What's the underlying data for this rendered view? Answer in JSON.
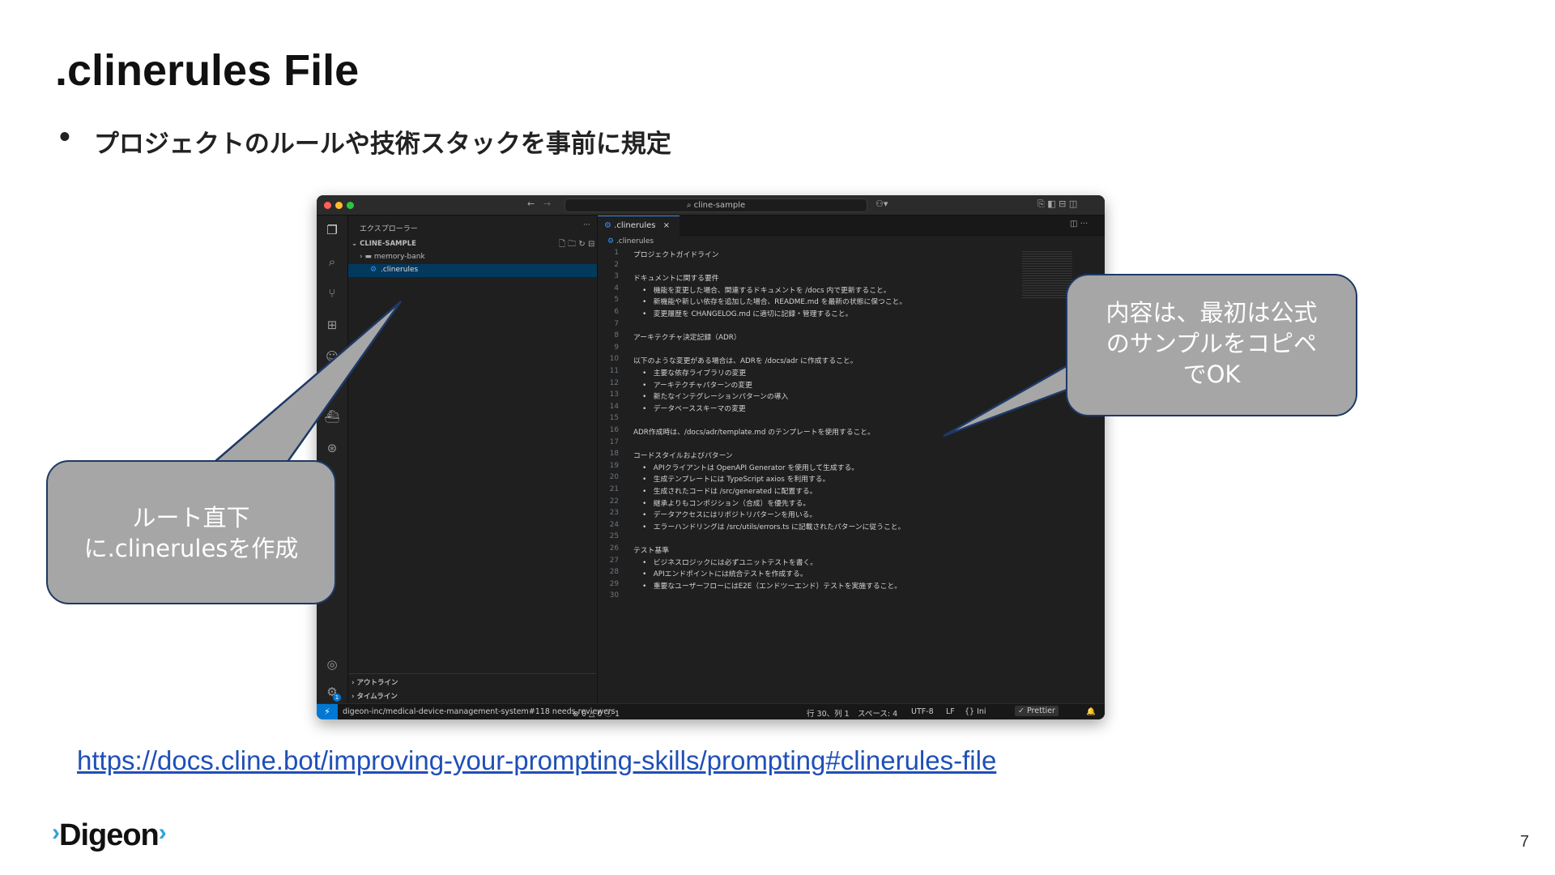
{
  "slide": {
    "title": ".clinerules File",
    "bullet_marker": "•",
    "bullet_text": "プロジェクトのルールや技術スタックを事前に規定",
    "link": "https://docs.cline.bot/improving-your-prompting-skills/prompting#clinerules-file",
    "page_number": "7",
    "logo": "Digeon",
    "colors": {
      "link": "#1f4fb8",
      "callout_fill": "#a6a6a6",
      "callout_border": "#1d3966",
      "logo_accent": "#2ea3d8"
    }
  },
  "callouts": {
    "left": {
      "line1": "ルート直下",
      "line2": "に.clinerulesを作成"
    },
    "right": {
      "line1": "内容は、最初は公式",
      "line2": "のサンプルをコピペ",
      "line3": "でOK"
    }
  },
  "vscode": {
    "command_center": "cline-sample",
    "nav_back": "←",
    "nav_forward": "→",
    "explorer_title": "エクスプローラー",
    "explorer_more": "···",
    "workspace_name": "CLINE-SAMPLE",
    "tree": [
      {
        "label": "memory-bank",
        "kind": "folder"
      },
      {
        "label": ".clinerules",
        "kind": "file"
      }
    ],
    "outline_label": "アウトライン",
    "timeline_label": "タイムライン",
    "tab_label": ".clinerules",
    "tab_close": "×",
    "breadcrumb": ".clinerules",
    "code_lines": [
      "プロジェクトガイドライン",
      "",
      "ドキュメントに関する要件",
      "    •   機能を変更した場合、関連するドキュメントを /docs 内で更新すること。",
      "    •   新機能や新しい依存を追加した場合、README.md を最新の状態に保つこと。",
      "    •   変更履歴を CHANGELOG.md に適切に記録・管理すること。",
      "",
      "アーキテクチャ決定記録（ADR）",
      "",
      "以下のような変更がある場合は、ADRを /docs/adr に作成すること。",
      "    •   主要な依存ライブラリの変更",
      "    •   アーキテクチャパターンの変更",
      "    •   新たなインテグレーションパターンの導入",
      "    •   データベーススキーマの変更",
      "",
      "ADR作成時は、/docs/adr/template.md のテンプレートを使用すること。",
      "",
      "コードスタイルおよびパターン",
      "    •   APIクライアントは OpenAPI Generator を使用して生成する。",
      "    •   生成テンプレートには TypeScript axios を利用する。",
      "    •   生成されたコードは /src/generated に配置する。",
      "    •   継承よりもコンポジション（合成）を優先する。",
      "    •   データアクセスにはリポジトリパターンを用いる。",
      "    •   エラーハンドリングは /src/utils/errors.ts に記載されたパターンに従うこと。",
      "",
      "テスト基準",
      "    •   ビジネスロジックには必ずユニットテストを書く。",
      "    •   APIエンドポイントには統合テストを作成する。",
      "    •   重要なユーザーフローにはE2E（エンドツーエンド）テストを実施すること。",
      ""
    ],
    "status": {
      "remote": "⚡",
      "branch": "digeon-inc/medical-device-management-system#118 needs reviewers",
      "problems": "⊗ 0 △ 0 ⓘ 1",
      "cursor": "行 30、列 1",
      "spaces": "スペース: 4",
      "encoding": "UTF-8",
      "eol": "LF",
      "language": "{} Ini",
      "prettier": "✓ Prettier",
      "settings_badge": "1"
    },
    "icons": [
      "files-icon",
      "search-icon",
      "source-control-icon",
      "extensions-icon",
      "accounts-icon",
      "settings-gear-icon"
    ]
  }
}
